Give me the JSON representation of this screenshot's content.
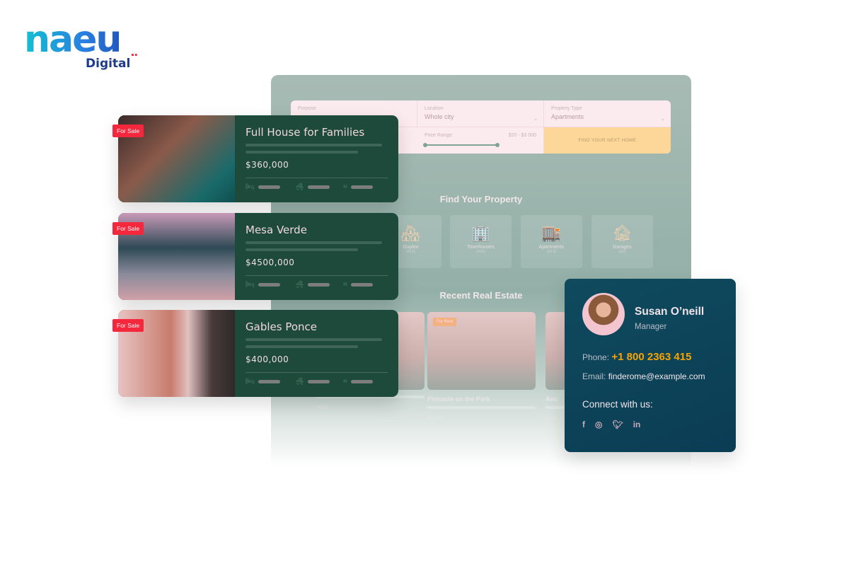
{
  "logo": {
    "word": "naeu",
    "sub": "Digital"
  },
  "search": {
    "purpose_label": "Purpose",
    "location_label": "Location",
    "location_value": "Whole city",
    "type_label": "Property Type",
    "type_value": "Apartments",
    "price_label": "Price Range:",
    "price_value": "$20 - $3 000",
    "button": "FIND YOUR NEXT HOME"
  },
  "find_title": "Find Your Property",
  "categories": [
    {
      "name": "Duplex",
      "count": "(415)"
    },
    {
      "name": "Townhouses",
      "count": "(415)"
    },
    {
      "name": "Apartments",
      "count": "(413)"
    },
    {
      "name": "Garages",
      "count": "(52)"
    }
  ],
  "recent_title": "Recent Real Estate",
  "recent": [
    {
      "title": "",
      "price": "$900",
      "tag": ""
    },
    {
      "title": "Pinnacle on the Park",
      "price": "$1,200",
      "tag": "For Rent"
    },
    {
      "title": "Ava",
      "price": "$1,5",
      "tag": ""
    }
  ],
  "listings": [
    {
      "badge": "For Sale",
      "name": "Full House for Families",
      "price": "$360,000",
      "photo": "linear-gradient(135deg,#3a2a2a,#8a5a4a 40%,#1a6a6a 80%,#0f4f50)"
    },
    {
      "badge": "For Sale",
      "name": "Mesa Verde",
      "price": "$4500,000",
      "photo": "linear-gradient(180deg,#c89ab8,#2e4a55 40%,#8a8a9a 70%,#d0a0a8)"
    },
    {
      "badge": "For Sale",
      "name": "Gables Ponce",
      "price": "$400,000",
      "photo": "linear-gradient(90deg,#e7c3c3,#c87c6c 45%,#e0c0c0 60%,#4a3a3a 80%,#2e2a2a)"
    }
  ],
  "contact": {
    "name": "Susan O’neill",
    "role": "Manager",
    "phone_label": "Phone:",
    "phone": "+1 800 2363 415",
    "email_label": "Email:",
    "email": "finderome@example.com",
    "connect": "Connect with us:",
    "social": [
      "facebook-icon",
      "instagram-icon",
      "twitter-icon",
      "linkedin-icon"
    ]
  },
  "colors": {
    "accent": "#f8a400",
    "badge": "#f5273c",
    "card": "#1e4a3c",
    "contact": "#0f4a5e",
    "button": "#fdd79a"
  }
}
